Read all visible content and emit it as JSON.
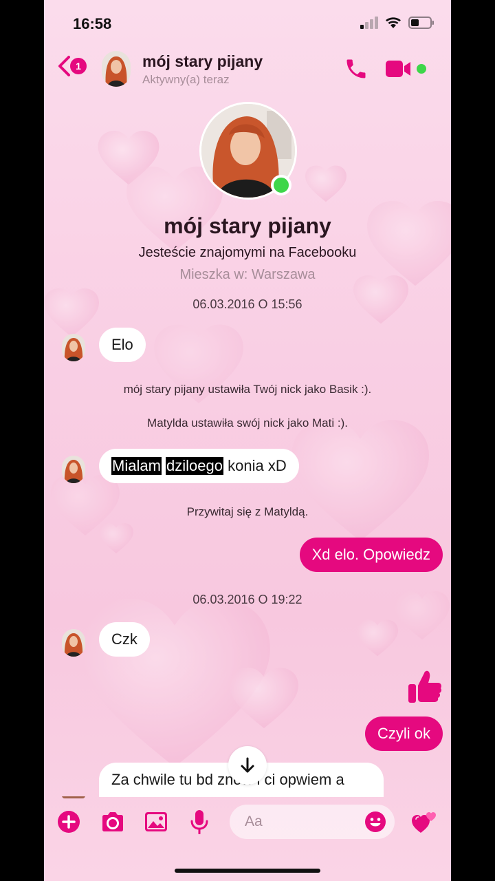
{
  "status_bar": {
    "time": "16:58"
  },
  "header": {
    "unread_badge": "1",
    "name": "mój stary pijany",
    "status": "Aktywny(a) teraz"
  },
  "profile": {
    "name": "mój stary pijany",
    "friends_line": "Jesteście znajomymi na Facebooku",
    "city_line": "Mieszka w: Warszawa"
  },
  "conversation": {
    "timestamp_1": "06.03.2016 O 15:56",
    "msg_elo": "Elo",
    "system_1": "mój stary pijany ustawiła Twój nick jako Basik :).",
    "system_2": "Matylda ustawiła swój nick jako Mati :).",
    "msg_2_word_1": "Mialam",
    "msg_2_word_2": "dziloego",
    "msg_2_rest": "konia xD",
    "system_3": "Przywitaj się z Matyldą.",
    "msg_out_1": "Xd elo. Opowiedz",
    "timestamp_2": "06.03.2016 O 19:22",
    "msg_czk": "Czk",
    "msg_out_2": "Czyli ok",
    "msg_partial": "Za chwile tu bd znow i ci opwiem a"
  },
  "composer": {
    "placeholder": "Aa"
  },
  "colors": {
    "accent": "#e5097f",
    "online": "#3ed64a",
    "bg": "#f9cfe4"
  },
  "icons": [
    "back-chevron-icon",
    "phone-icon",
    "video-camera-icon",
    "thumbs-up-icon",
    "arrow-down-icon",
    "plus-icon",
    "camera-icon",
    "image-icon",
    "microphone-icon",
    "emoji-icon",
    "hearts-icon"
  ]
}
